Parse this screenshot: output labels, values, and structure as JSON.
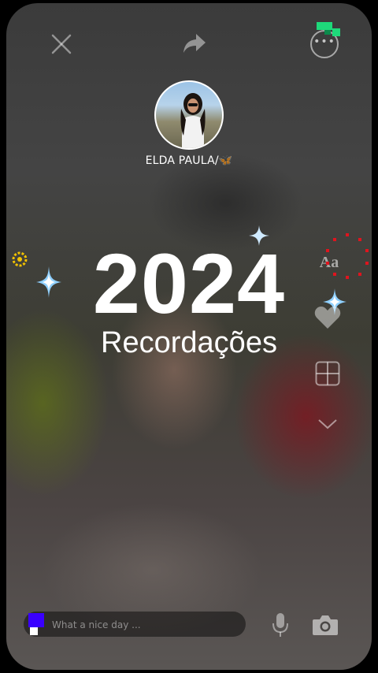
{
  "header": {
    "close_icon": "close-icon",
    "share_icon": "share-icon",
    "more_icon": "more-options-icon"
  },
  "profile": {
    "username": "ELDA PAULA/🦋"
  },
  "story": {
    "year": "2024",
    "subtitle": "Recordações"
  },
  "side_tools": {
    "text_tool_label": "Aa",
    "heart_icon": "heart-icon",
    "layout_icon": "layout-grid-icon",
    "collapse_icon": "chevron-down-icon"
  },
  "composer": {
    "placeholder": "What a nice day ...",
    "mic_icon": "microphone-icon",
    "camera_icon": "camera-icon"
  },
  "colors": {
    "accent_blue": "#3a00ff",
    "badge_green": "#1ed97a",
    "sparkle_blue": "#7ec9ff",
    "ring_red": "#e0141e",
    "gear_gold": "#f2c200"
  }
}
